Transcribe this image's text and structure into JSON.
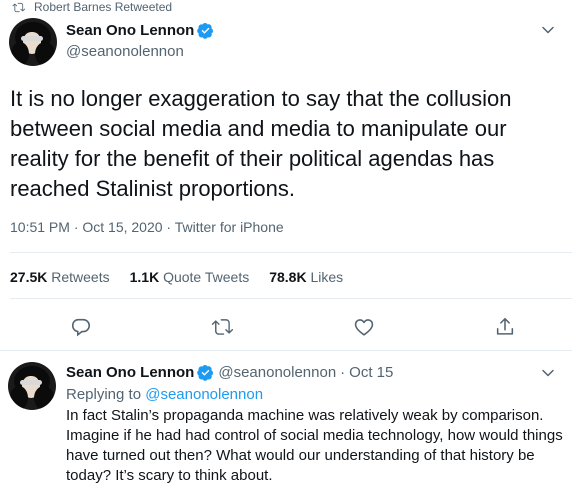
{
  "retweet_context": {
    "label": "Robert Barnes Retweeted",
    "icon": "retweet-icon"
  },
  "main_tweet": {
    "author_name": "Sean Ono Lennon",
    "author_handle": "@seanonolennon",
    "verified": true,
    "text": "It is no longer exaggeration to say that the collusion\nbetween social media and media to manipulate our\nreality for the benefit of their political agendas has\nreached Stalinist proportions.",
    "time": "10:51 PM · Oct 15, 2020 · ",
    "source": "Twitter for iPhone",
    "stats": {
      "retweets_count": "27.5K",
      "retweets_label": "Retweets",
      "quote_count": "1.1K",
      "quote_label": "Quote Tweets",
      "likes_count": "78.8K",
      "likes_label": "Likes"
    },
    "actions": [
      "reply-icon",
      "retweet-icon",
      "like-icon",
      "share-icon"
    ]
  },
  "reply_tweet": {
    "author_name": "Sean Ono Lennon",
    "author_handle": "@seanonolennon",
    "separator": "·",
    "date": "Oct 15",
    "replying_prefix": "Replying to ",
    "replying_mention": "@seanonolennon",
    "text": "In fact Stalin’s propaganda machine was relatively weak by comparison.\nImagine if he had had control of social media technology, how would things\nhave turned out then? What would our understanding of that history be\ntoday? It’s scary to think about."
  },
  "colors": {
    "accent": "#1d9bf0",
    "muted": "#536471",
    "text": "#0f1419",
    "divider": "#e6ecf0"
  }
}
